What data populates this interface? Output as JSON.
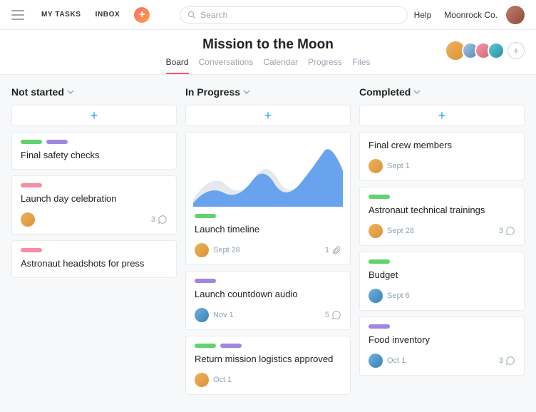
{
  "nav": {
    "my_tasks": "MY TASKS",
    "inbox": "INBOX",
    "search_placeholder": "Search",
    "help": "Help",
    "org": "Moonrock Co."
  },
  "project": {
    "title": "Mission to the Moon",
    "tabs": {
      "board": "Board",
      "conversations": "Conversations",
      "calendar": "Calendar",
      "progress": "Progress",
      "files": "Files"
    }
  },
  "columns": {
    "not_started": {
      "title": "Not started",
      "cards": [
        {
          "title": "Final safety checks"
        },
        {
          "title": "Launch day celebration",
          "comments": "3"
        },
        {
          "title": "Astronaut headshots for press"
        }
      ]
    },
    "in_progress": {
      "title": "In Progress",
      "cards": [
        {
          "title": "Launch timeline",
          "date": "Sept 28",
          "attachments": "1"
        },
        {
          "title": "Launch countdown audio",
          "date": "Nov 1",
          "comments": "5"
        },
        {
          "title": "Return mission logistics approved",
          "date": "Oct 1"
        }
      ]
    },
    "completed": {
      "title": "Completed",
      "cards": [
        {
          "title": "Final crew members",
          "date": "Sept 1"
        },
        {
          "title": "Astronaut technical trainings",
          "date": "Sept 28",
          "comments": "3"
        },
        {
          "title": "Budget",
          "date": "Sept 6"
        },
        {
          "title": "Food inventory",
          "date": "Oct 1",
          "comments": "3"
        }
      ]
    }
  }
}
